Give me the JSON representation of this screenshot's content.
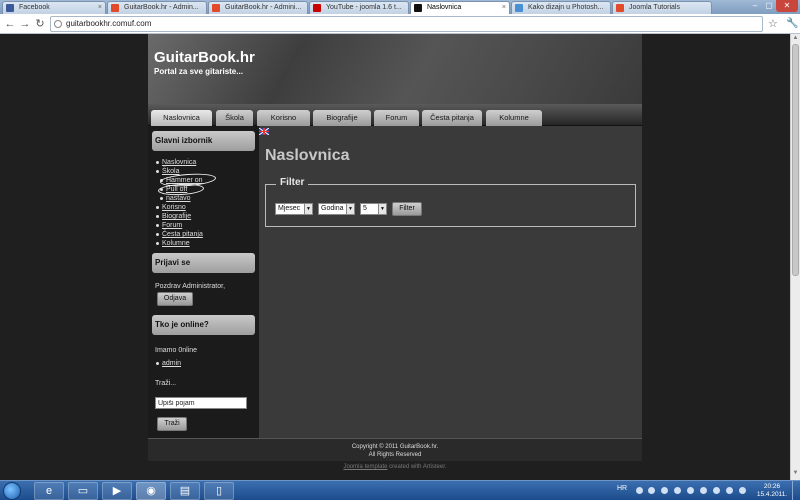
{
  "browser": {
    "tabs": [
      {
        "label": "Facebook",
        "active": false
      },
      {
        "label": "GuitarBook.hr - Admin...",
        "active": false
      },
      {
        "label": "GuitarBook.hr - Admini...",
        "active": false
      },
      {
        "label": "YouTube - joomla 1.6 t...",
        "active": false
      },
      {
        "label": "Naslovnica",
        "active": true
      },
      {
        "label": "Kako dizajn u Photosh...",
        "active": false
      },
      {
        "label": "Joomla Tutorials",
        "active": false
      }
    ],
    "url": "guitarbookhr.comuf.com",
    "icons": {
      "back": "back-arrow-icon",
      "forward": "forward-arrow-icon",
      "reload": "reload-icon",
      "bookmark": "star-icon",
      "menu": "wrench-icon"
    }
  },
  "site": {
    "title": "GuitarBook.hr",
    "slogan": "Portal za sve gitariste...",
    "nav": [
      "Naslovnica",
      "Škola",
      "Korisno",
      "Biografije",
      "Forum",
      "Česta pitanja",
      "Kolumne"
    ],
    "active_nav": "Naslovnica"
  },
  "sidebar": {
    "main_menu": {
      "title": "Glavni izbornik",
      "items": [
        "Naslovnica",
        "Škola",
        "Hammer on",
        "Pull off",
        "nastavo",
        "Korisno",
        "Biografije",
        "Forum",
        "Česta pitanja",
        "Kolumne"
      ]
    },
    "login": {
      "title": "Prijavi se",
      "greeting": "Pozdrav Administrator,",
      "logout_label": "Odjava"
    },
    "online": {
      "title": "Tko je online?",
      "count_text": "Imamo 0nline",
      "users": [
        "admin"
      ]
    },
    "search": {
      "label": "Traži...",
      "input_value": "Upiši pojam",
      "button_label": "Traži"
    }
  },
  "main": {
    "heading": "Naslovnica",
    "filter": {
      "legend": "Filter",
      "month": "Mjesec",
      "year": "Godina",
      "limit": "5",
      "button_label": "Filter"
    }
  },
  "footer": {
    "line1": "Copyright © 2011 GuitarBook.hr.",
    "line2": "All Rights Reserved",
    "credits_link": "Joomla template",
    "credits_text": " created with Artisteer."
  },
  "taskbar": {
    "language": "HR",
    "time": "20:26",
    "date": "15.4.2011."
  },
  "colors": {
    "page_bg": "#1f1f1f",
    "content_bg": "#3a3a3a",
    "sidebar_bg": "#1b1b1b",
    "taskbar": "#1d4c8c"
  }
}
